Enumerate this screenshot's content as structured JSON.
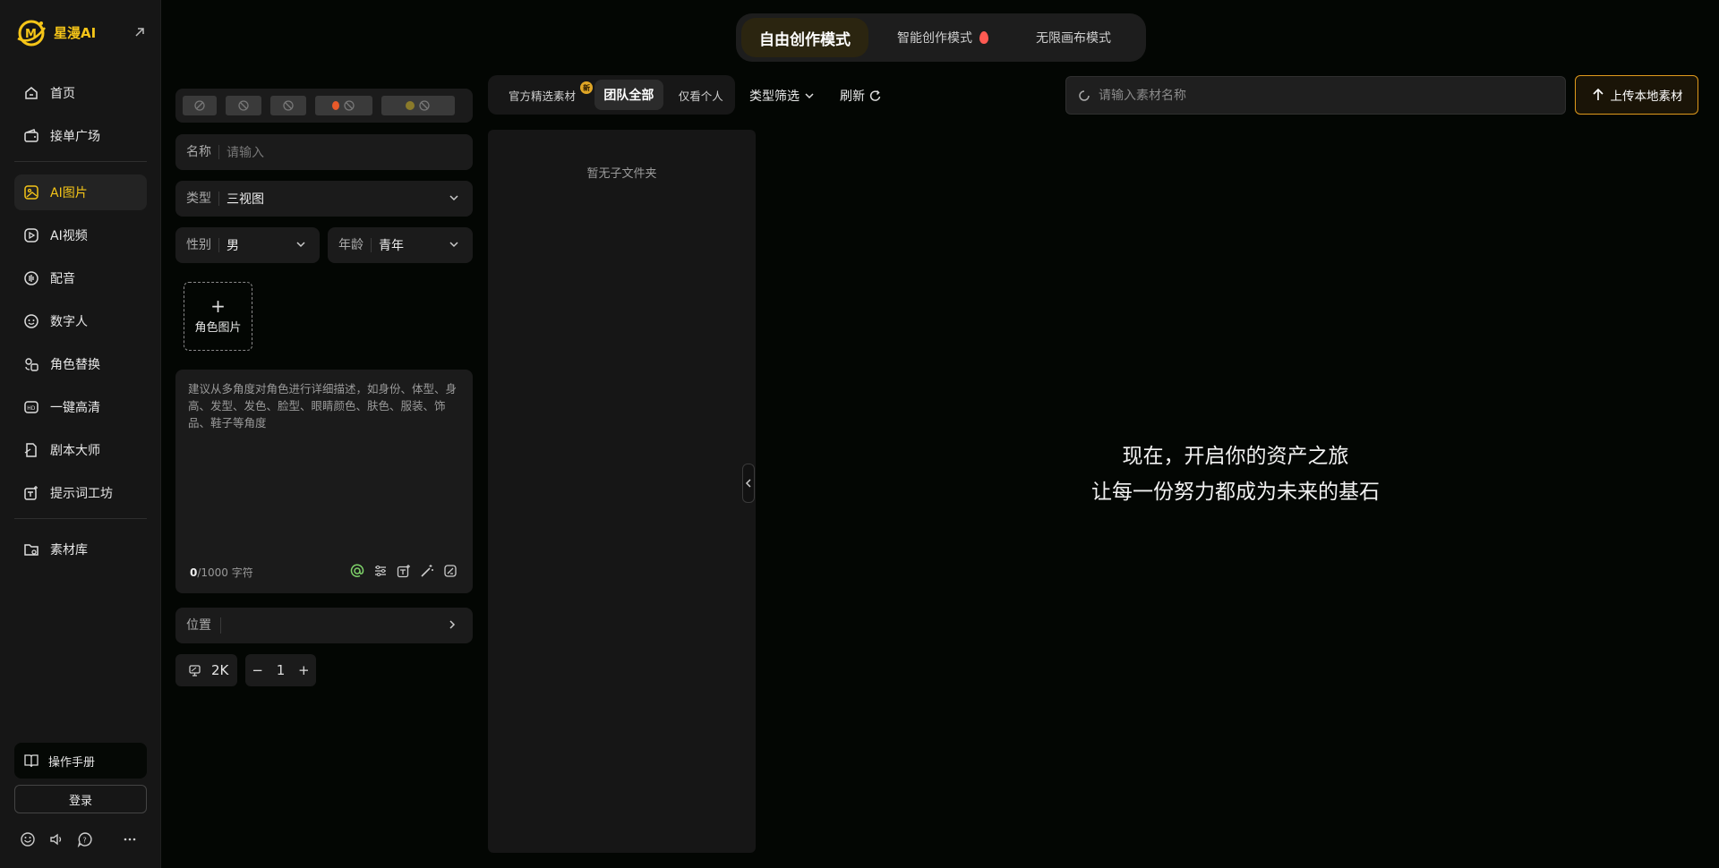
{
  "brand": {
    "name": "星漫AI"
  },
  "sidebar": {
    "group1": [
      {
        "label": "首页",
        "icon": "home-icon"
      },
      {
        "label": "接单广场",
        "icon": "wallet-icon"
      }
    ],
    "group2": [
      {
        "label": "AI图片",
        "icon": "image-icon",
        "active": true
      },
      {
        "label": "AI视频",
        "icon": "video-icon"
      },
      {
        "label": "配音",
        "icon": "audio-icon"
      },
      {
        "label": "数字人",
        "icon": "avatar-face-icon"
      },
      {
        "label": "角色替换",
        "icon": "swap-icon"
      },
      {
        "label": "一键高清",
        "icon": "hd-icon"
      },
      {
        "label": "剧本大师",
        "icon": "script-icon"
      },
      {
        "label": "提示词工坊",
        "icon": "prompt-icon"
      }
    ],
    "group3": [
      {
        "label": "素材库",
        "icon": "folder-icon"
      }
    ],
    "manual_label": "操作手册",
    "login_label": "登录"
  },
  "modes": {
    "free": "自由创作模式",
    "smart": "智能创作模式",
    "canvas": "无限画布模式"
  },
  "form": {
    "name_label": "名称",
    "name_placeholder": "请输入",
    "type_label": "类型",
    "type_value": "三视图",
    "gender_label": "性别",
    "gender_value": "男",
    "age_label": "年龄",
    "age_value": "青年",
    "role_image_label": "角色图片",
    "description_placeholder": "建议从多角度对角色进行详细描述，如身份、体型、身高、发型、发色、脸型、眼睛颜色、肤色、服装、饰品、鞋子等角度",
    "char_count": "0",
    "char_limit": "/1000 字符",
    "position_label": "位置",
    "resolution": "2K",
    "quantity": "1"
  },
  "library": {
    "tabs": [
      {
        "label": "官方精选素材",
        "badge": "新"
      },
      {
        "label": "团队全部",
        "active": true
      },
      {
        "label": "仅看个人"
      }
    ],
    "type_filter_label": "类型筛选",
    "refresh_label": "刷新",
    "search_placeholder": "请输入素材名称",
    "upload_label": "上传本地素材",
    "empty_folder_text": "暂无子文件夹",
    "hero_line1": "现在，开启你的资产之旅",
    "hero_line2": "让每一份努力都成为未来的基石"
  },
  "colors": {
    "accent": "#f5c518",
    "upload_border": "#e09a1c",
    "flame": "#ff5a52"
  }
}
